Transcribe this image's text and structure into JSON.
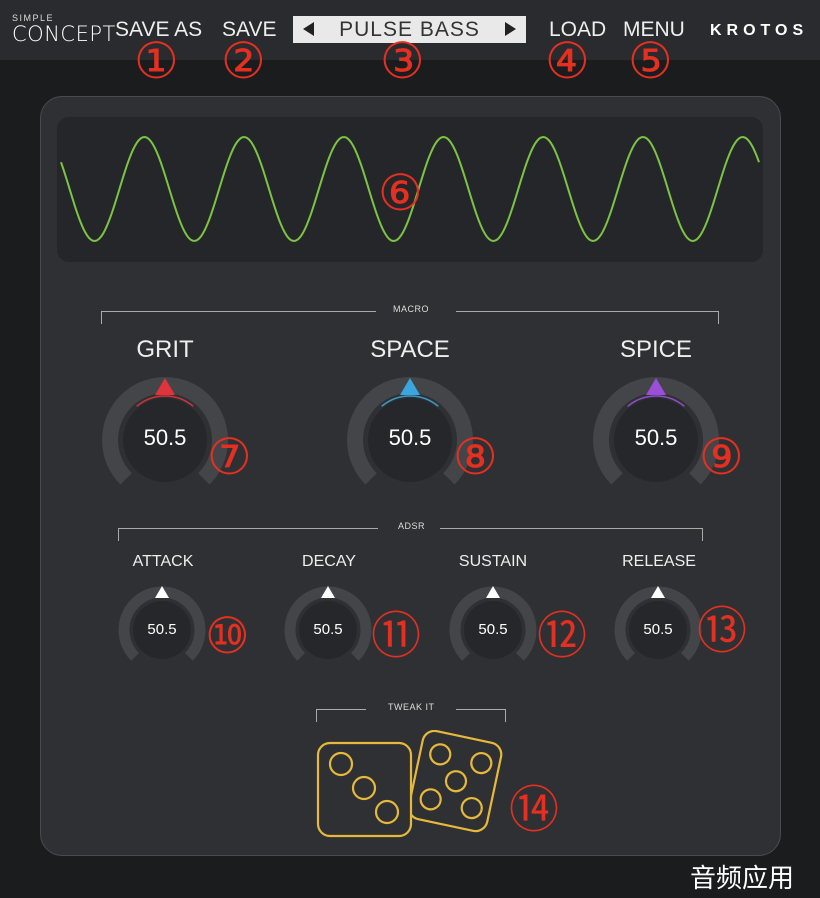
{
  "header": {
    "brand_small": "SIMPLE",
    "brand_big": "CONCEPT",
    "save_as_label": "SAVE AS",
    "save_label": "SAVE",
    "preset_name": "PULSE BASS",
    "load_label": "LOAD",
    "menu_label": "MENU",
    "logo": "KROTOS"
  },
  "markers": [
    "①",
    "②",
    "③",
    "④",
    "⑤",
    "⑥",
    "⑦",
    "⑧",
    "⑨",
    "⑩",
    "⑪",
    "⑫",
    "⑬",
    "⑭"
  ],
  "macro": {
    "label": "MACRO",
    "knobs": [
      {
        "title": "GRIT",
        "value": "50.5",
        "color": "#e0333c"
      },
      {
        "title": "SPACE",
        "value": "50.5",
        "color": "#3aa6dd"
      },
      {
        "title": "SPICE",
        "value": "50.5",
        "color": "#9b4fd9"
      }
    ]
  },
  "adsr": {
    "label": "ADSR",
    "knobs": [
      {
        "title": "ATTACK",
        "value": "50.5"
      },
      {
        "title": "DECAY",
        "value": "50.5"
      },
      {
        "title": "SUSTAIN",
        "value": "50.5"
      },
      {
        "title": "RELEASE",
        "value": "50.5"
      }
    ]
  },
  "tweak": {
    "label": "TWEAK IT",
    "icon": "dice-icon"
  },
  "waveform": {
    "color": "#7cc443",
    "cycles": 7
  },
  "watermark": "音频应用"
}
